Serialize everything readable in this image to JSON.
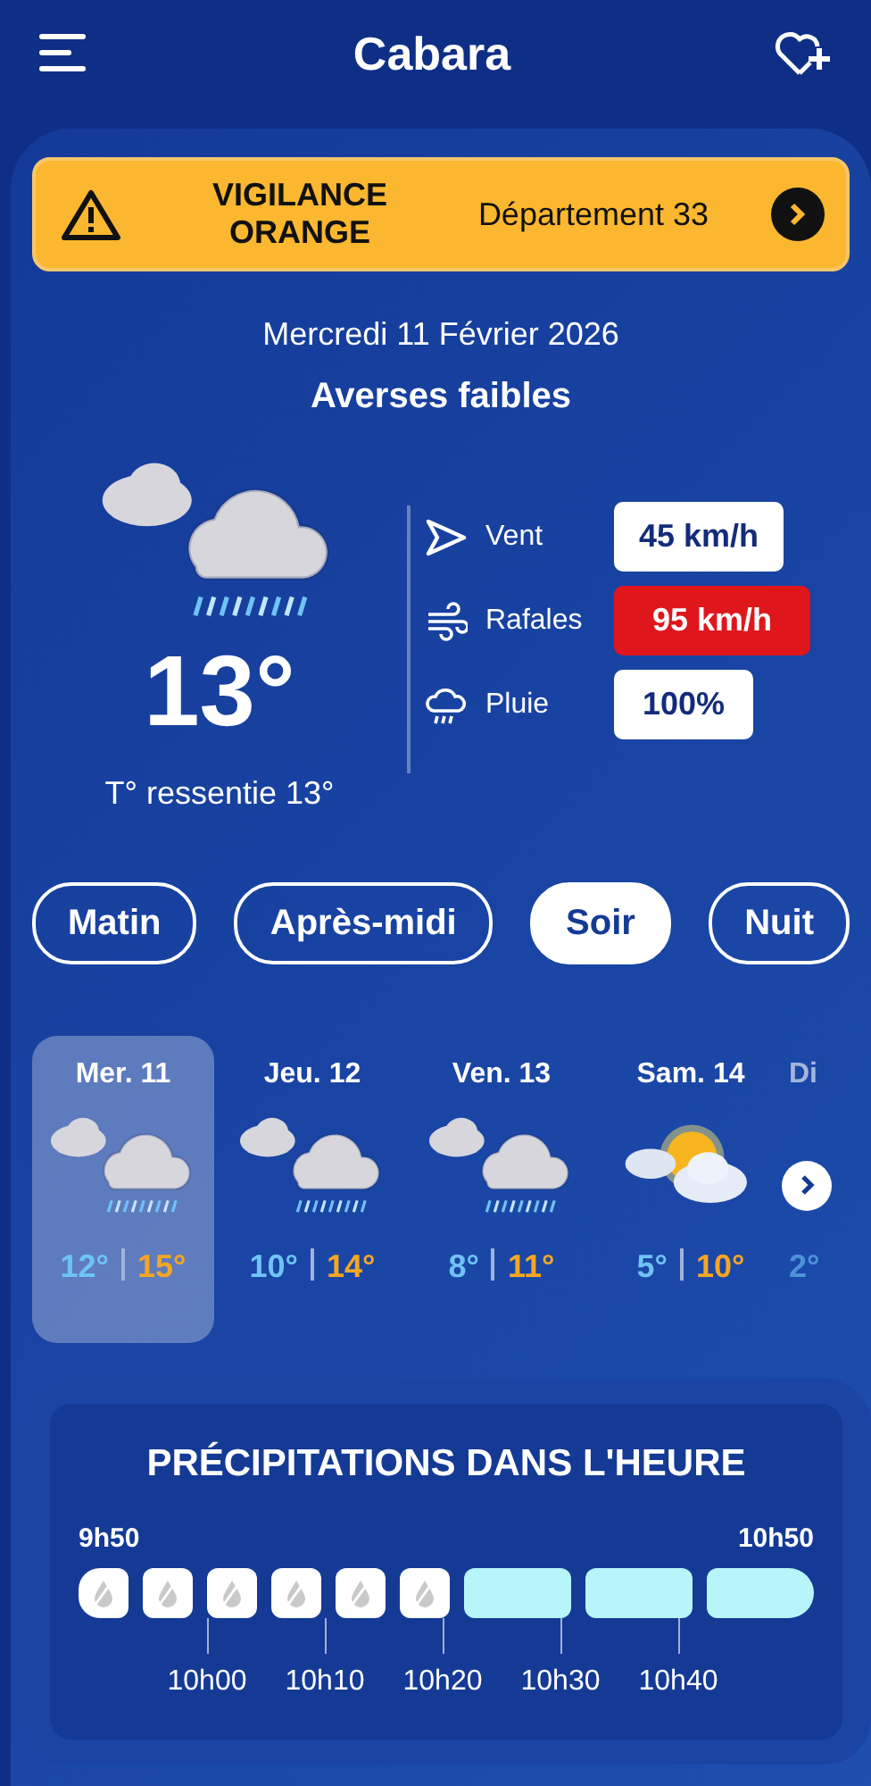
{
  "header": {
    "title": "Cabara"
  },
  "alert": {
    "title": "VIGILANCE ORANGE",
    "area": "Département 33"
  },
  "current": {
    "date": "Mercredi 11 Février 2026",
    "condition": "Averses faibles",
    "kind": "rain_cloud",
    "temperature": "13°",
    "feels_like": "T° ressentie 13°"
  },
  "stats": [
    {
      "kind": "wind",
      "label": "Vent",
      "value": "45 km/h",
      "alert": false
    },
    {
      "kind": "gust",
      "label": "Rafales",
      "value": "95 km/h",
      "alert": true
    },
    {
      "kind": "rain",
      "label": "Pluie",
      "value": "100%",
      "alert": false
    }
  ],
  "periods": [
    {
      "label": "Matin",
      "selected": false
    },
    {
      "label": "Après-midi",
      "selected": false
    },
    {
      "label": "Soir",
      "selected": true
    },
    {
      "label": "Nuit",
      "selected": false
    }
  ],
  "days": [
    {
      "label": "Mer. 11",
      "kind": "rain_cloud",
      "low": "12°",
      "high": "15°",
      "selected": true
    },
    {
      "label": "Jeu. 12",
      "kind": "rain_cloud",
      "low": "10°",
      "high": "14°",
      "selected": false
    },
    {
      "label": "Ven. 13",
      "kind": "rain_cloud",
      "low": "8°",
      "high": "11°",
      "selected": false
    },
    {
      "label": "Sam. 14",
      "kind": "sun_cloud",
      "low": "5°",
      "high": "10°",
      "selected": false
    },
    {
      "label": "Di",
      "low": "2°",
      "selected": false
    }
  ],
  "precipitation": {
    "title": "PRÉCIPITATIONS DANS L'HEURE",
    "start": "9h50",
    "end": "10h50",
    "segments": [
      {
        "kind": "none"
      },
      {
        "kind": "none"
      },
      {
        "kind": "none"
      },
      {
        "kind": "none"
      },
      {
        "kind": "none"
      },
      {
        "kind": "none"
      },
      {
        "kind": "rain"
      },
      {
        "kind": "rain"
      },
      {
        "kind": "rain"
      }
    ],
    "ticks": [
      "10h00",
      "10h10",
      "10h20",
      "10h30",
      "10h40"
    ]
  }
}
